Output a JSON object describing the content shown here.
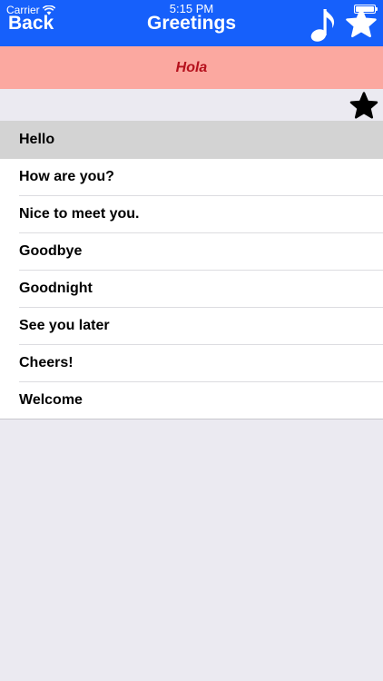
{
  "status_bar": {
    "carrier": "Carrier",
    "time": "5:15 PM",
    "battery_level": 1.0
  },
  "nav": {
    "back_label": "Back",
    "title": "Greetings",
    "music_icon": "music-note-icon",
    "favorites_icon": "star-icon"
  },
  "translation": {
    "text": "Hola"
  },
  "favorite_toggle_icon": "star-icon",
  "phrases": {
    "selected_index": 0,
    "items": [
      {
        "label": "Hello"
      },
      {
        "label": "How are you?"
      },
      {
        "label": "Nice to meet you."
      },
      {
        "label": "Goodbye"
      },
      {
        "label": "Goodnight"
      },
      {
        "label": "See you later"
      },
      {
        "label": "Cheers!"
      },
      {
        "label": "Welcome"
      }
    ]
  },
  "colors": {
    "header": "#1660fb",
    "translation_background": "#fba8a0",
    "translation_text": "#b5101c",
    "selected_row": "#d3d3d3",
    "page_background": "#ebeaf1"
  }
}
